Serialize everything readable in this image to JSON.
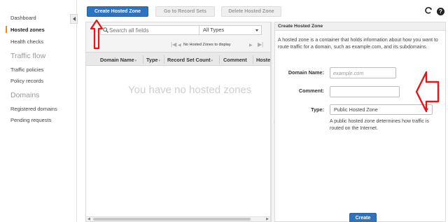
{
  "sidebar": {
    "items": [
      {
        "label": "Dashboard"
      },
      {
        "label": "Hosted zones"
      },
      {
        "label": "Health checks"
      }
    ],
    "section_traffic": "Traffic flow",
    "traffic_items": [
      {
        "label": "Traffic policies"
      },
      {
        "label": "Policy records"
      }
    ],
    "section_domains": "Domains",
    "domain_items": [
      {
        "label": "Registered domains"
      },
      {
        "label": "Pending requests"
      }
    ]
  },
  "toolbar": {
    "create_label": "Create Hosted Zone",
    "record_sets_label": "Go to Record Sets",
    "delete_label": "Delete Hosted Zone",
    "refresh_icon": "refresh-icon",
    "help_icon": "help-icon",
    "help_glyph": "?"
  },
  "list": {
    "search_placeholder": "Search all fields",
    "clear_glyph": "✕",
    "filter_select": "All Types",
    "pager_text": "No Hosted Zones to display",
    "columns": [
      {
        "label": "Domain Name"
      },
      {
        "label": "Type"
      },
      {
        "label": "Record Set Count"
      },
      {
        "label": "Comment"
      },
      {
        "label": "Hoste"
      }
    ],
    "empty_message": "You have no hosted zones"
  },
  "create_panel": {
    "title": "Create Hosted Zone",
    "description": "A hosted zone is a container that holds information about how you want to route traffic for a domain, such as example.com, and its subdomains.",
    "domain_label": "Domain Name:",
    "domain_placeholder": "example.com",
    "comment_label": "Comment:",
    "comment_value": "",
    "type_label": "Type:",
    "type_value": "Public Hosted Zone",
    "type_help": "A public hosted zone determines how traffic is routed on the Internet.",
    "create_button": "Create"
  },
  "colors": {
    "primary": "#2d73c2",
    "accent_active": "#e98a1a",
    "annotation": "#e8141a"
  }
}
